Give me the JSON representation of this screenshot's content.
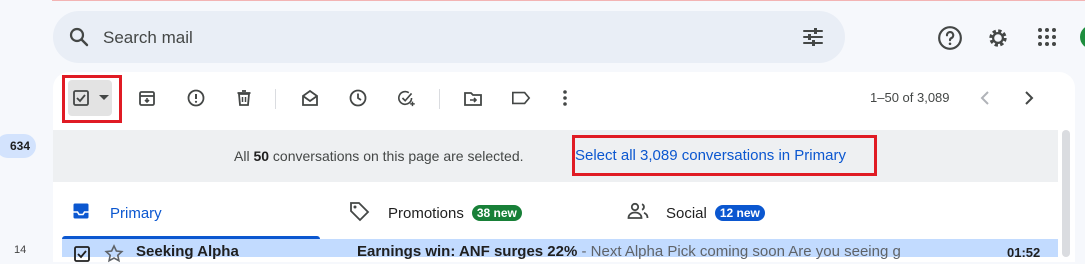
{
  "sidebar": {
    "inbox_count": "634",
    "small_count": "14"
  },
  "search": {
    "placeholder": "Search mail"
  },
  "toolbar": {
    "pagination": "1–50 of 3,089"
  },
  "banner": {
    "prefix": "All ",
    "count": "50",
    "suffix": " conversations on this page are selected.",
    "select_all_link": "Select all 3,089 conversations in Primary"
  },
  "tabs": [
    {
      "label": "Primary",
      "badge": ""
    },
    {
      "label": "Promotions",
      "badge": "38 new",
      "badge_color": "#188038"
    },
    {
      "label": "Social",
      "badge": "12 new",
      "badge_color": "#0b57d0"
    }
  ],
  "email_row": {
    "sender": "Seeking Alpha",
    "subject": "Earnings win: ANF surges 22%",
    "snippet": " - Next Alpha Pick coming soon Are you seeing g",
    "time": "01:52"
  },
  "colors": {
    "accent": "#0b57d0",
    "highlight": "#e01b24",
    "selected_row": "#c2dbff"
  }
}
